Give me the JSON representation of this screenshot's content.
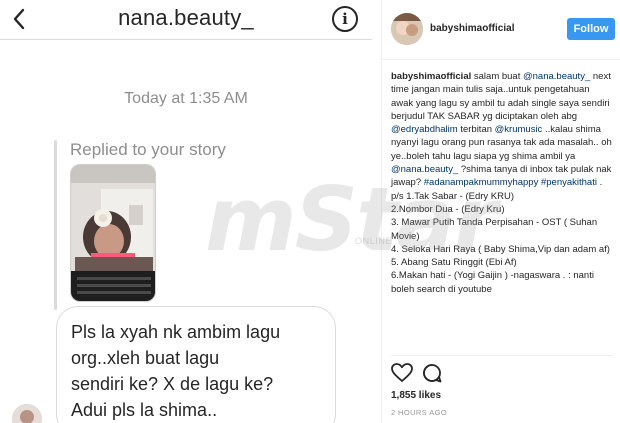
{
  "dm": {
    "title": "nana.beauty_",
    "info_label": "i",
    "timestamp": "Today at 1:35 AM",
    "story_reply_label": "Replied to your story",
    "message": "Pls la xyah nk ambim lagu\norg..xleh buat lagu\nsendiri ke? X de lagu ke?\nAdui pls la shima.."
  },
  "post": {
    "username": "babyshimaofficial",
    "follow_label": "Follow",
    "caption": [
      {
        "t": "babyshimaofficial",
        "k": "user"
      },
      {
        "t": " salam buat ",
        "k": "text"
      },
      {
        "t": "@nana.beauty_",
        "k": "mention"
      },
      {
        "t": " next time jangan main tulis saja..untuk pengetahuan awak yang lagu sy ambil tu adah single saya sendiri berjudul TAK SABAR yg diciptakan oleh abg ",
        "k": "text"
      },
      {
        "t": "@edryabdhalim",
        "k": "mention"
      },
      {
        "t": " terbitan ",
        "k": "text"
      },
      {
        "t": "@krumusic",
        "k": "mention"
      },
      {
        "t": " ..kalau shima nyanyi lagu orang pun rasanya tak ada masalah.. oh ye..boleh tahu lagu siapa yg shima ambil ya ",
        "k": "text"
      },
      {
        "t": "@nana.beauty_",
        "k": "mention"
      },
      {
        "t": " ?shima tanya di inbox tak pulak nak jawap? ",
        "k": "text"
      },
      {
        "t": "#adanampakmummyhappy",
        "k": "tag"
      },
      {
        "t": " ",
        "k": "text"
      },
      {
        "t": "#penyakithati",
        "k": "tag"
      },
      {
        "t": " . p/s 1.Tak Sabar - (Edry KRU)",
        "k": "text"
      },
      {
        "t": "2.Nombor Dua - (Edry Kru)",
        "k": "line"
      },
      {
        "t": "3. Mawar Putih Tanda Perpisahan - OST ( Suhan Movie)",
        "k": "line"
      },
      {
        "t": "4. Seloka Hari Raya ( Baby Shima,Vip dan adam af)",
        "k": "line"
      },
      {
        "t": "5. Abang Satu Ringgit (Ebi Af)",
        "k": "line"
      },
      {
        "t": "6.Makan hati - (Yogi Gaijin ) -nagaswara . : nanti boleh search di youtube",
        "k": "line"
      }
    ],
    "likes": "1,855 likes",
    "time": "2 HOURS AGO"
  },
  "icons": {
    "back": "chevron-left-icon",
    "info": "info-icon",
    "like": "heart-icon",
    "comment": "comment-icon"
  },
  "colors": {
    "follow_button": "#3897f0",
    "link": "#003569",
    "muted_text": "#8e8e8e"
  },
  "watermark": {
    "text": "mStar",
    "sub": "ONLINE"
  }
}
